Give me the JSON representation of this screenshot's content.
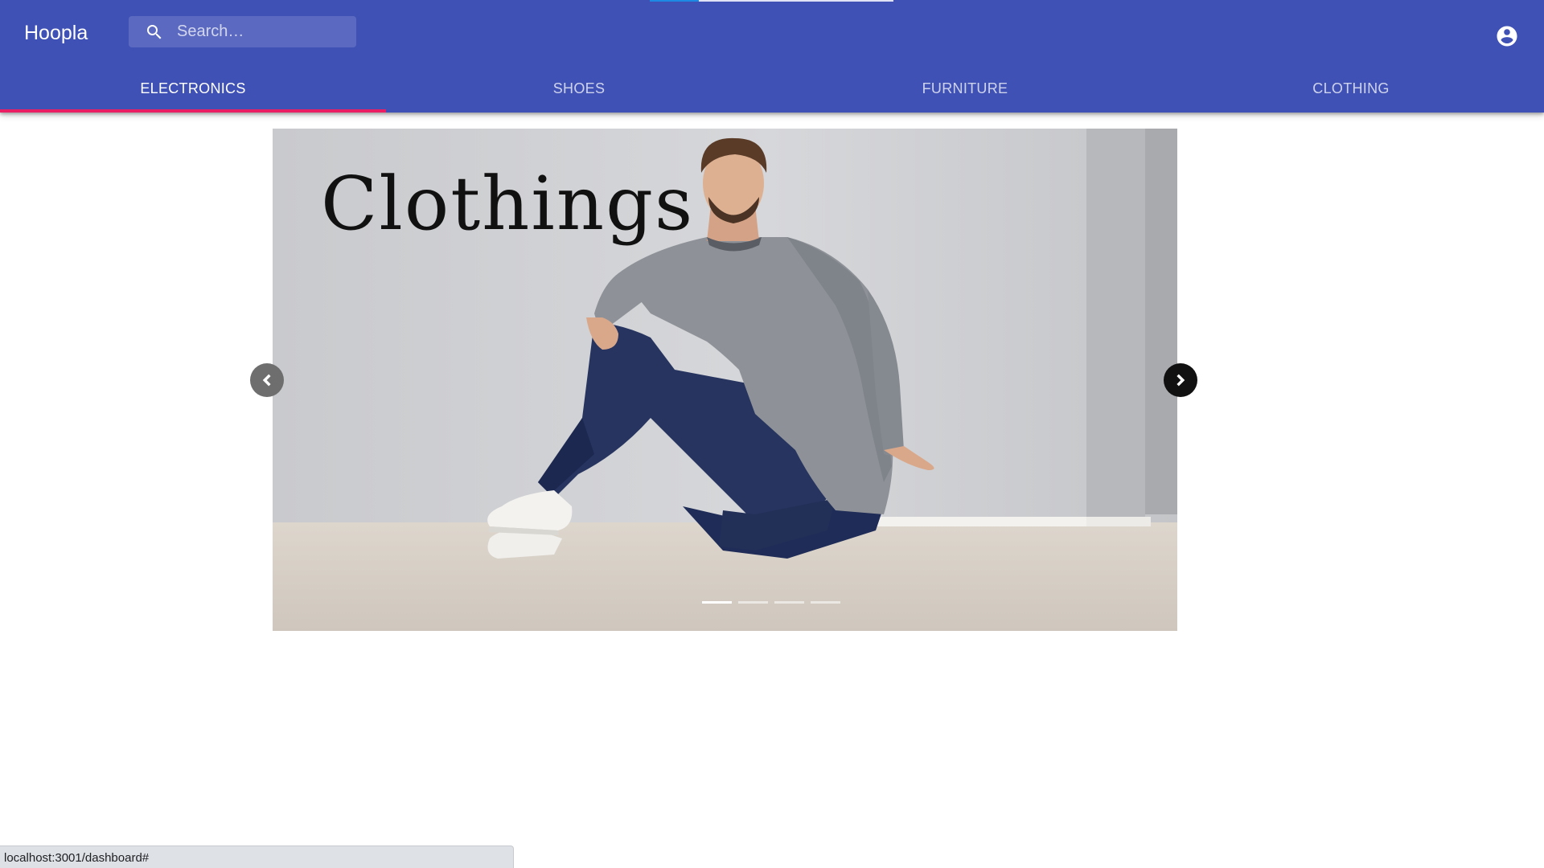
{
  "app": {
    "brand": "Hoopla"
  },
  "loading": {
    "progress": 0.2
  },
  "search": {
    "placeholder": "Search…",
    "value": "",
    "icon": "search-icon"
  },
  "account": {
    "icon": "account-circle-icon"
  },
  "tabs": [
    {
      "label": "ELECTRONICS",
      "active": true
    },
    {
      "label": "SHOES",
      "active": false
    },
    {
      "label": "FURNITURE",
      "active": false
    },
    {
      "label": "CLOTHING",
      "active": false
    }
  ],
  "carousel": {
    "caption": "Clothings",
    "prev_icon": "chevron-left-icon",
    "next_icon": "chevron-right-icon",
    "slide_count": 4,
    "active_index": 0
  },
  "status": {
    "url": "localhost:3001/dashboard#"
  },
  "colors": {
    "appbar": "#3f51b5",
    "tab_indicator": "#e91e63",
    "loading": "#1e88e5"
  }
}
